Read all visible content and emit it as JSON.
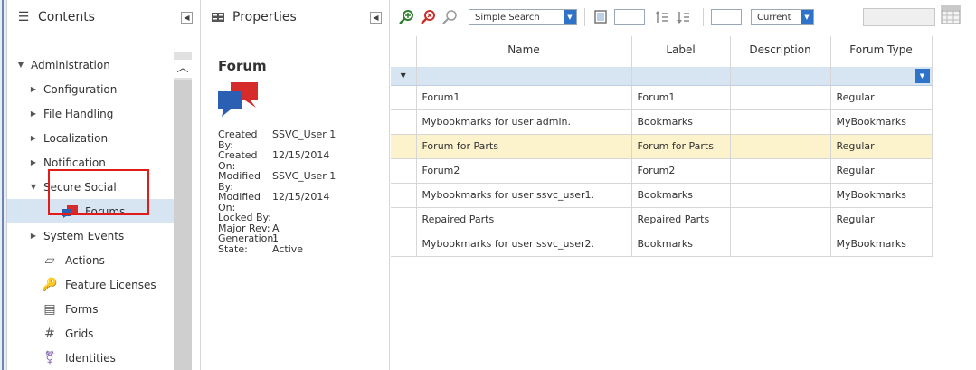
{
  "contents_panel": {
    "title": "Contents",
    "tree": [
      {
        "label": "Administration",
        "state": "expanded",
        "indent": 0
      },
      {
        "label": "Configuration",
        "state": "collapsed",
        "indent": 1
      },
      {
        "label": "File Handling",
        "state": "collapsed",
        "indent": 1
      },
      {
        "label": "Localization",
        "state": "collapsed",
        "indent": 1
      },
      {
        "label": "Notification",
        "state": "collapsed",
        "indent": 1
      },
      {
        "label": "Secure Social",
        "state": "expanded",
        "indent": 1
      },
      {
        "label": "Forums",
        "state": "leaf",
        "indent": 2,
        "selected": true
      },
      {
        "label": "System Events",
        "state": "collapsed",
        "indent": 1
      },
      {
        "label": "Actions",
        "state": "leaf",
        "indent": 1
      },
      {
        "label": "Feature Licenses",
        "state": "leaf",
        "indent": 1
      },
      {
        "label": "Forms",
        "state": "leaf",
        "indent": 1
      },
      {
        "label": "Grids",
        "state": "leaf",
        "indent": 1
      },
      {
        "label": "Identities",
        "state": "leaf",
        "indent": 1
      }
    ]
  },
  "properties_panel": {
    "title": "Properties",
    "item_title": "Forum",
    "props": [
      {
        "key": "Created By:",
        "value": "SSVC_User 1"
      },
      {
        "key": "Created On:",
        "value": "12/15/2014"
      },
      {
        "key": "Modified By:",
        "value": "SSVC_User 1"
      },
      {
        "key": "Modified On:",
        "value": "12/15/2014"
      },
      {
        "key": "Locked By:",
        "value": ""
      },
      {
        "key": "Major Rev:",
        "value": "A"
      },
      {
        "key": "Generation:",
        "value": "1"
      },
      {
        "key": "State:",
        "value": "Active"
      }
    ]
  },
  "toolbar": {
    "search_mode": "Simple Search",
    "current_label": "Current"
  },
  "grid": {
    "columns": [
      "Name",
      "Label",
      "Description",
      "Forum Type"
    ],
    "rows": [
      {
        "name": "Forum1",
        "label": "Forum1",
        "description": "",
        "type": "Regular"
      },
      {
        "name": "Mybookmarks for user admin.",
        "label": "Bookmarks",
        "description": "",
        "type": "MyBookmarks"
      },
      {
        "name": "Forum for Parts",
        "label": "Forum for Parts",
        "description": "",
        "type": "Regular",
        "highlighted": true
      },
      {
        "name": "Forum2",
        "label": "Forum2",
        "description": "",
        "type": "Regular"
      },
      {
        "name": "Mybookmarks for user ssvc_user1.",
        "label": "Bookmarks",
        "description": "",
        "type": "MyBookmarks"
      },
      {
        "name": "Repaired Parts",
        "label": "Repaired Parts",
        "description": "",
        "type": "Regular"
      },
      {
        "name": "Mybookmarks for user ssvc_user2.",
        "label": "Bookmarks",
        "description": "",
        "type": "MyBookmarks"
      }
    ]
  },
  "colors": {
    "accent": "#2e72c9",
    "selection": "#d7e4f2",
    "row_highlight": "#fcf2cc",
    "annotation_box": "#e21b1b"
  }
}
